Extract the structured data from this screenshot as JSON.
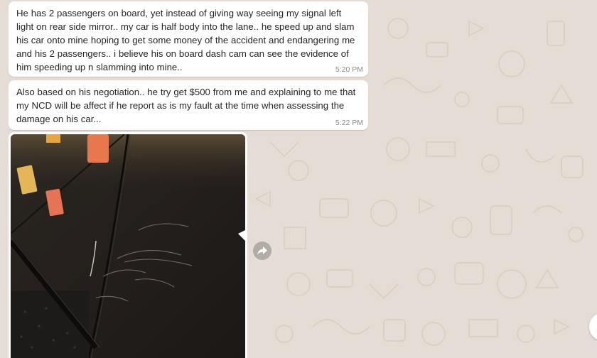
{
  "chat": {
    "messages": [
      {
        "text": "He has 2 passengers on board, yet instead of giving way seeing my signal left light on rear side mirror.. my car is half body into the lane..  he speed up and slam his car onto mine hoping to get some money of the accident and endangering me and his 2 passengers.. i believe his on board dash cam can see the evidence of him speeding up n slamming into mine..",
        "time": "5:20 PM"
      },
      {
        "text": "Also based on his negotiation.. he try get $500 from me and explaining to me that my NCD will be affect if he report as is my fault at the time when assessing the damage on his car...",
        "time": "5:22 PM"
      }
    ],
    "photo": {
      "description_icon": "image-icon"
    },
    "forward_icon": "forward-arrow-icon",
    "scroll_icon": "scroll-down-icon"
  },
  "colors": {
    "chat_background": "#e5ddd5",
    "bubble_background": "#ffffff",
    "timestamp": "#8b8b8b",
    "text": "#262626"
  }
}
